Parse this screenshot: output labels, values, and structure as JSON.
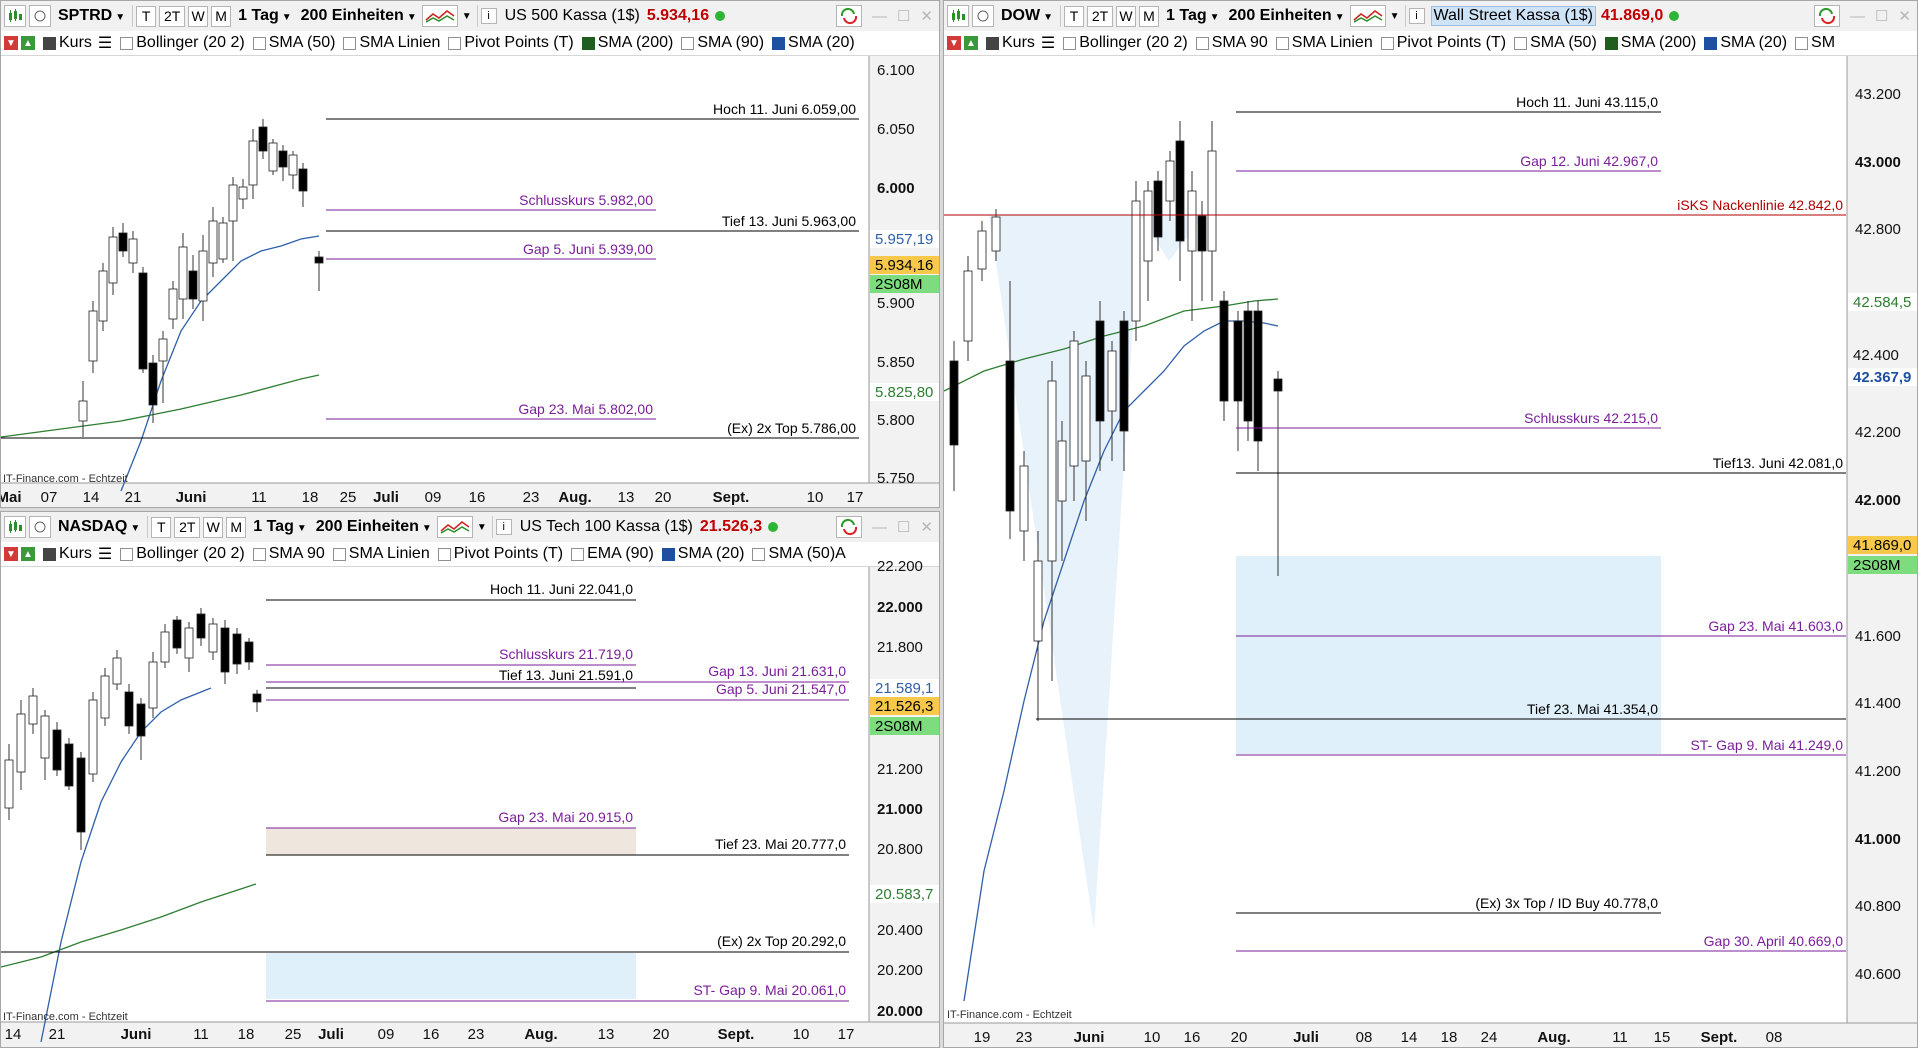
{
  "common": {
    "timeframe": "1 Tag",
    "units": "200 Einheiten",
    "kurs": "Kurs",
    "source": "IT-Finance.com - Echtzeit"
  },
  "sp": {
    "symbol": "SPTRD",
    "instrument": "US 500 Kassa (1$)",
    "price": "5.934,16",
    "indicators": [
      "Bollinger (20 2)",
      "SMA (50)",
      "SMA Linien",
      "Pivot Points (T)",
      "SMA (200)",
      "SMA (90)",
      "SMA (20)"
    ],
    "indicator_colors": [
      "#fff",
      "#fff",
      "#fff",
      "#fff",
      "#1f5e1f",
      "#fff",
      "#1f4fa0"
    ],
    "yticks": [
      {
        "v": "6.100",
        "b": false
      },
      {
        "v": "6.050",
        "b": false
      },
      {
        "v": "6.000",
        "b": true
      },
      {
        "v": "5.900",
        "b": false
      },
      {
        "v": "5.850",
        "b": false
      },
      {
        "v": "5.800",
        "b": false
      },
      {
        "v": "5.750",
        "b": false
      }
    ],
    "xticks": [
      {
        "t": "Mai",
        "b": true
      },
      {
        "t": "07",
        "b": false
      },
      {
        "t": "14",
        "b": false
      },
      {
        "t": "21",
        "b": false
      },
      {
        "t": "Juni",
        "b": true
      },
      {
        "t": "11",
        "b": false
      },
      {
        "t": "18",
        "b": false
      },
      {
        "t": "25",
        "b": false
      },
      {
        "t": "Juli",
        "b": true
      },
      {
        "t": "09",
        "b": false
      },
      {
        "t": "16",
        "b": false
      },
      {
        "t": "23",
        "b": false
      },
      {
        "t": "Aug.",
        "b": true
      },
      {
        "t": "13",
        "b": false
      },
      {
        "t": "20",
        "b": false
      },
      {
        "t": "Sept.",
        "b": true
      },
      {
        "t": "10",
        "b": false
      },
      {
        "t": "17",
        "b": false
      }
    ],
    "levels": [
      {
        "label": "Hoch 11. Juni 6.059,00",
        "color": "#000"
      },
      {
        "label": "Schlusskurs 5.982,00",
        "color": "#7a1f9a"
      },
      {
        "label": "Tief 13. Juni 5.963,00",
        "color": "#000"
      },
      {
        "label": "Gap 5. Juni 5.939,00",
        "color": "#7a1f9a"
      },
      {
        "label": "Gap 23. Mai 5.802,00",
        "color": "#7a1f9a"
      },
      {
        "label": "(Ex) 2x Top  5.786,00",
        "color": "#000"
      }
    ],
    "axis_tags": [
      {
        "v": "5.957,19",
        "kind": "blue"
      },
      {
        "v": "5.934,16",
        "kind": "yellow"
      },
      {
        "v": "2S08M",
        "kind": "green"
      },
      {
        "v": "5.825,80",
        "kind": "greenline"
      }
    ]
  },
  "nq": {
    "symbol": "NASDAQ",
    "instrument": "US Tech 100 Kassa (1$)",
    "price": "21.526,3",
    "indicators": [
      "Bollinger (20 2)",
      "SMA 90",
      "SMA Linien",
      "Pivot Points (T)",
      "EMA (90)",
      "SMA (20)",
      "SMA (50)"
    ],
    "indicator_colors": [
      "#fff",
      "#fff",
      "#fff",
      "#fff",
      "#fff",
      "#1f4fa0",
      "#fff"
    ],
    "extra_letter": "A",
    "yticks": [
      {
        "v": "22.200",
        "b": false
      },
      {
        "v": "22.000",
        "b": true
      },
      {
        "v": "21.800",
        "b": false
      },
      {
        "v": "21.200",
        "b": false
      },
      {
        "v": "21.000",
        "b": true
      },
      {
        "v": "20.800",
        "b": false
      },
      {
        "v": "20.400",
        "b": false
      },
      {
        "v": "20.200",
        "b": false
      },
      {
        "v": "20.000",
        "b": true
      }
    ],
    "xticks": [
      {
        "t": "14",
        "b": false
      },
      {
        "t": "21",
        "b": false
      },
      {
        "t": "Juni",
        "b": true
      },
      {
        "t": "11",
        "b": false
      },
      {
        "t": "18",
        "b": false
      },
      {
        "t": "25",
        "b": false
      },
      {
        "t": "Juli",
        "b": true
      },
      {
        "t": "09",
        "b": false
      },
      {
        "t": "16",
        "b": false
      },
      {
        "t": "23",
        "b": false
      },
      {
        "t": "Aug.",
        "b": true
      },
      {
        "t": "13",
        "b": false
      },
      {
        "t": "20",
        "b": false
      },
      {
        "t": "Sept.",
        "b": true
      },
      {
        "t": "10",
        "b": false
      },
      {
        "t": "17",
        "b": false
      }
    ],
    "levels": [
      {
        "label": "Hoch 11. Juni 22.041,0",
        "color": "#000"
      },
      {
        "label": "Schlusskurs 21.719,0",
        "color": "#7a1f9a"
      },
      {
        "label": "Gap 13. Juni 21.631,0",
        "color": "#7a1f9a"
      },
      {
        "label": "Tief 13. Juni 21.591,0",
        "color": "#000"
      },
      {
        "label": "Gap 5. Juni 21.547,0",
        "color": "#7a1f9a"
      },
      {
        "label": "Gap 23. Mai 20.915,0",
        "color": "#7a1f9a"
      },
      {
        "label": "Tief 23. Mai 20.777,0",
        "color": "#000"
      },
      {
        "label": "(Ex) 2x Top  20.292,0",
        "color": "#000"
      },
      {
        "label": "ST- Gap 9. Mai 20.061,0",
        "color": "#7a1f9a"
      }
    ],
    "axis_tags": [
      {
        "v": "21.589,1",
        "kind": "blue"
      },
      {
        "v": "21.526,3",
        "kind": "yellow"
      },
      {
        "v": "2S08M",
        "kind": "green"
      },
      {
        "v": "20.583,7",
        "kind": "greenline"
      }
    ]
  },
  "dow": {
    "symbol": "DOW",
    "instrument": "Wall Street Kassa (1$)",
    "price": "41.869,0",
    "indicators": [
      "Bollinger (20 2)",
      "SMA 90",
      "SMA Linien",
      "Pivot Points (T)",
      "SMA (50)",
      "SMA (200)",
      "SMA (20)",
      "SM"
    ],
    "indicator_colors": [
      "#fff",
      "#fff",
      "#fff",
      "#fff",
      "#fff",
      "#1f5e1f",
      "#1f4fa0",
      "#fff"
    ],
    "yticks": [
      {
        "v": "43.200",
        "b": false
      },
      {
        "v": "43.000",
        "b": true
      },
      {
        "v": "42.800",
        "b": false
      },
      {
        "v": "42.200",
        "b": false
      },
      {
        "v": "42.000",
        "b": true
      },
      {
        "v": "41.600",
        "b": false
      },
      {
        "v": "41.400",
        "b": false
      },
      {
        "v": "41.200",
        "b": false
      },
      {
        "v": "41.000",
        "b": true
      },
      {
        "v": "40.800",
        "b": false
      },
      {
        "v": "40.600",
        "b": false
      }
    ],
    "xticks": [
      {
        "t": "19",
        "b": false
      },
      {
        "t": "23",
        "b": false
      },
      {
        "t": "Juni",
        "b": true
      },
      {
        "t": "10",
        "b": false
      },
      {
        "t": "16",
        "b": false
      },
      {
        "t": "20",
        "b": false
      },
      {
        "t": "Juli",
        "b": true
      },
      {
        "t": "08",
        "b": false
      },
      {
        "t": "14",
        "b": false
      },
      {
        "t": "18",
        "b": false
      },
      {
        "t": "24",
        "b": false
      },
      {
        "t": "Aug.",
        "b": true
      },
      {
        "t": "11",
        "b": false
      },
      {
        "t": "15",
        "b": false
      },
      {
        "t": "Sept.",
        "b": true
      },
      {
        "t": "08",
        "b": false
      }
    ],
    "levels": [
      {
        "label": "Hoch 11. Juni 43.115,0",
        "color": "#000"
      },
      {
        "label": "Gap 12. Juni 42.967,0",
        "color": "#7a1f9a"
      },
      {
        "label": "iSKS Nackenlinie 42.842,0",
        "color": "#b00000"
      },
      {
        "label": "Schlusskurs 42.215,0",
        "color": "#7a1f9a"
      },
      {
        "label": "Tief13. Juni 42.081,0",
        "color": "#000"
      },
      {
        "label": "Gap  23. Mai 41.603,0",
        "color": "#7a1f9a"
      },
      {
        "label": "Tief  23. Mai 41.354,0",
        "color": "#000"
      },
      {
        "label": "ST- Gap 9. Mai  41.249,0",
        "color": "#7a1f9a"
      },
      {
        "label": "(Ex) 3x Top /  ID Buy  40.778,0",
        "color": "#000"
      },
      {
        "label": "Gap 30. April 40.669,0",
        "color": "#7a1f9a"
      }
    ],
    "axis_tags": [
      {
        "v": "42.584,5",
        "kind": "greenline"
      },
      {
        "v": "42.400",
        "kind": "plain"
      },
      {
        "v": "42.367,9",
        "kind": "bluebold"
      },
      {
        "v": "41.869,0",
        "kind": "yellow"
      },
      {
        "v": "2S08M",
        "kind": "green"
      }
    ]
  }
}
